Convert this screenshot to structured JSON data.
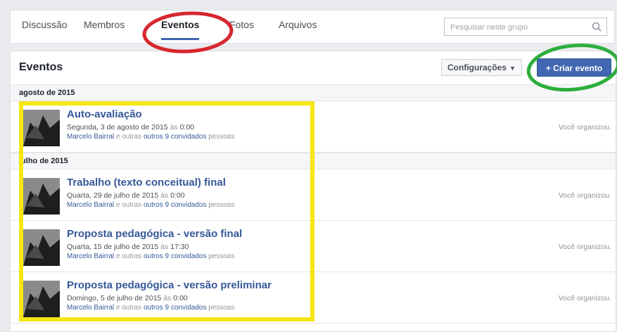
{
  "tabs": [
    "Discussão",
    "Membros",
    "Eventos",
    "Fotos",
    "Arquivos"
  ],
  "active_tab": 2,
  "search": {
    "placeholder": "Pesquisar neste grupo"
  },
  "panel": {
    "title": "Eventos",
    "config_label": "Configurações",
    "create_label": "+ Criar evento"
  },
  "months": [
    "agosto de 2015",
    "julho de 2015"
  ],
  "events": [
    {
      "title": "Auto-avaliação",
      "date": "Segunda, 3 de agosto de 2015",
      "at": "às",
      "time": "0:00",
      "host": "Marcelo Bairral",
      "guests_mid": "e outras",
      "guests_link": "outros 9 convidados",
      "guests_end": "pessoas",
      "status": "Você organizou."
    },
    {
      "title": "Trabalho (texto conceitual) final",
      "date": "Quarta, 29 de julho de 2015",
      "at": "às",
      "time": "0:00",
      "host": "Marcelo Bairral",
      "guests_mid": "e outras",
      "guests_link": "outros 9 convidados",
      "guests_end": "pessoas",
      "status": "Você organizou."
    },
    {
      "title": "Proposta pedagógica - versão final",
      "date": "Quarta, 15 de julho de 2015",
      "at": "às",
      "time": "17:30",
      "host": "Marcelo Bairral",
      "guests_mid": "e outras",
      "guests_link": "outros 9 convidados",
      "guests_end": "pessoas",
      "status": "Você organizou."
    },
    {
      "title": "Proposta pedagógica - versão preliminar",
      "date": "Domingo, 5 de julho de 2015",
      "at": "às",
      "time": "0:00",
      "host": "Marcelo Bairral",
      "guests_mid": "e outras",
      "guests_link": "outros 9 convidados",
      "guests_end": "pessoas",
      "status": "Você organizou."
    }
  ],
  "annotation_colors": {
    "red": "#d7262e",
    "green": "#2dae3c",
    "yellow": "#f5e614"
  },
  "accent": "#4267b2"
}
